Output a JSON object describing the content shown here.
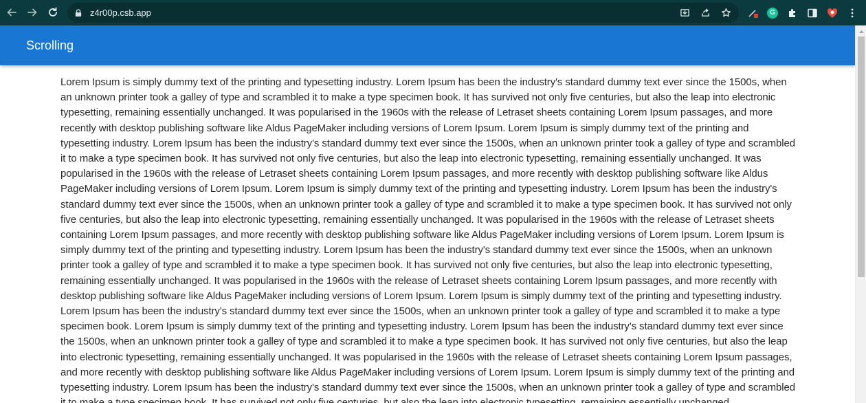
{
  "browser": {
    "url": "z4r00p.csb.app",
    "grammarly_badge": "G"
  },
  "app": {
    "title": "Scrolling"
  },
  "content": {
    "paragraph": "Lorem Ipsum is simply dummy text of the printing and typesetting industry. Lorem Ipsum has been the industry's standard dummy text ever since the 1500s, when an unknown printer took a galley of type and scrambled it to make a type specimen book. It has survived not only five centuries, but also the leap into electronic typesetting, remaining essentially unchanged. It was popularised in the 1960s with the release of Letraset sheets containing Lorem Ipsum passages, and more recently with desktop publishing software like Aldus PageMaker including versions of Lorem Ipsum. Lorem Ipsum is simply dummy text of the printing and typesetting industry. Lorem Ipsum has been the industry's standard dummy text ever since the 1500s, when an unknown printer took a galley of type and scrambled it to make a type specimen book. It has survived not only five centuries, but also the leap into electronic typesetting, remaining essentially unchanged. It was popularised in the 1960s with the release of Letraset sheets containing Lorem Ipsum passages, and more recently with desktop publishing software like Aldus PageMaker including versions of Lorem Ipsum. Lorem Ipsum is simply dummy text of the printing and typesetting industry. Lorem Ipsum has been the industry's standard dummy text ever since the 1500s, when an unknown printer took a galley of type and scrambled it to make a type specimen book. It has survived not only five centuries, but also the leap into electronic typesetting, remaining essentially unchanged. It was popularised in the 1960s with the release of Letraset sheets containing Lorem Ipsum passages, and more recently with desktop publishing software like Aldus PageMaker including versions of Lorem Ipsum. Lorem Ipsum is simply dummy text of the printing and typesetting industry. Lorem Ipsum has been the industry's standard dummy text ever since the 1500s, when an unknown printer took a galley of type and scrambled it to make a type specimen book. It has survived not only five centuries, but also the leap into electronic typesetting, remaining essentially unchanged. It was popularised in the 1960s with the release of Letraset sheets containing Lorem Ipsum passages, and more recently with desktop publishing software like Aldus PageMaker including versions of Lorem Ipsum. Lorem Ipsum is simply dummy text of the printing and typesetting industry. Lorem Ipsum has been the industry's standard dummy text ever since the 1500s, when an unknown printer took a galley of type and scrambled it to make a type specimen book. Lorem Ipsum is simply dummy text of the printing and typesetting industry. Lorem Ipsum has been the industry's standard dummy text ever since the 1500s, when an unknown printer took a galley of type and scrambled it to make a type specimen book. It has survived not only five centuries, but also the leap into electronic typesetting, remaining essentially unchanged. It was popularised in the 1960s with the release of Letraset sheets containing Lorem Ipsum passages, and more recently with desktop publishing software like Aldus PageMaker including versions of Lorem Ipsum. Lorem Ipsum is simply dummy text of the printing and typesetting industry. Lorem Ipsum has been the industry's standard dummy text ever since the 1500s, when an unknown printer took a galley of type and scrambled it to make a type specimen book. It has survived not only five centuries, but also the leap into electronic typesetting, remaining essentially unchanged."
  },
  "colors": {
    "header": "#1976d2",
    "browser_bar": "#0b3a3f",
    "text": "#2a2a2a"
  }
}
